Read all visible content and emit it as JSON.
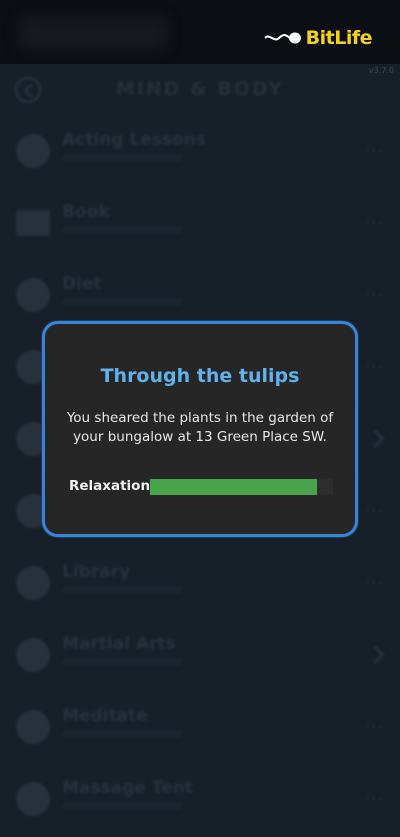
{
  "app": {
    "brand": "BitLife",
    "version": "v3.7.0"
  },
  "background_screen": {
    "title": "MIND & BODY",
    "items": [
      {
        "label": "Acting Lessons",
        "icon": "theater-icon"
      },
      {
        "label": "Book",
        "icon": "book-icon"
      },
      {
        "label": "Diet",
        "icon": "food-icon"
      },
      {
        "label": "",
        "icon": "generic-icon"
      },
      {
        "label": "",
        "icon": "generic-icon"
      },
      {
        "label": "",
        "icon": "generic-icon"
      },
      {
        "label": "Library",
        "icon": "library-icon"
      },
      {
        "label": "Martial Arts",
        "icon": "martial-arts-icon"
      },
      {
        "label": "Meditate",
        "icon": "meditation-icon"
      },
      {
        "label": "Massage Tent",
        "icon": "massage-icon"
      }
    ]
  },
  "dialog": {
    "title": "Through the tulips",
    "message": "You sheared the plants in the garden of your bungalow at 13 Green Place SW.",
    "stat": {
      "label": "Relaxation",
      "value_fraction": 0.91,
      "color": "#47a44a"
    }
  },
  "colors": {
    "accent": "#3a84d6",
    "title": "#5fb2ec",
    "brand": "#f4d21c"
  }
}
